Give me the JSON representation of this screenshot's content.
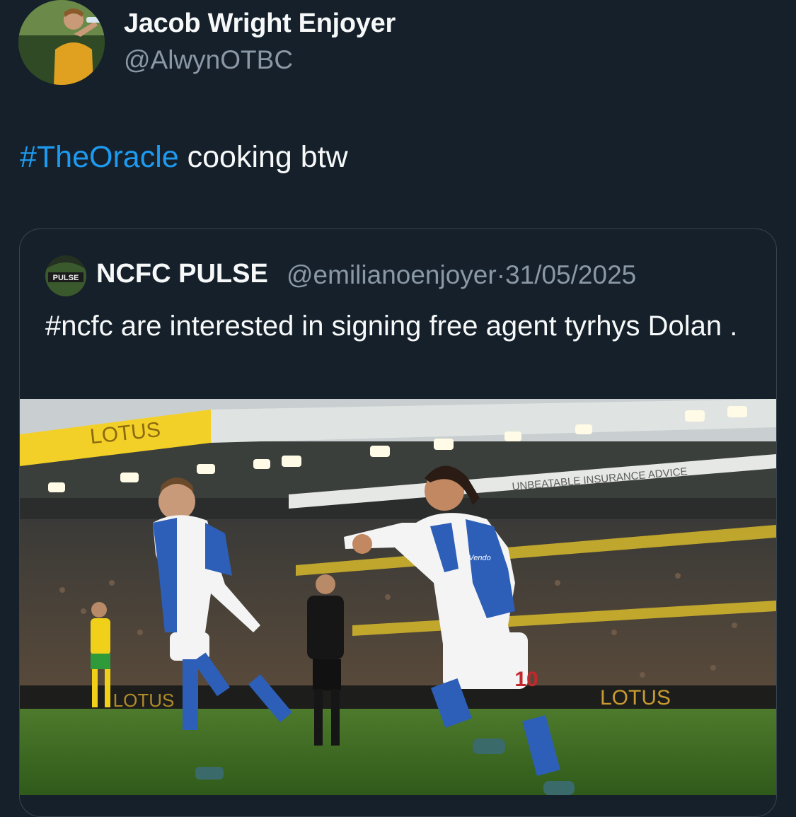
{
  "tweet": {
    "display_name": "Jacob Wright Enjoyer",
    "handle": "@AlwynOTBC",
    "hashtag": "#TheOracle",
    "text": " cooking btw"
  },
  "quote": {
    "display_name": "NCFC PULSE",
    "handle": "@emilianoenjoyer",
    "separator": "·",
    "date": "31/05/2025",
    "text": "#ncfc are interested in signing free agent tyrhys Dolan .",
    "avatar_logo_text": "PULSE",
    "media": {
      "stand_sign": "LOTUS",
      "pitchside_sign": "LOTUS",
      "left_sign": "LOTUS",
      "banner": "UNBEATABLE INSURANCE ADVICE",
      "sponsor": "Vendo",
      "player_number": "10"
    }
  },
  "colors": {
    "background": "#15202b",
    "text": "#f7f9f9",
    "secondary": "#8b98a5",
    "link": "#1d9bf0",
    "border": "#38444d"
  }
}
